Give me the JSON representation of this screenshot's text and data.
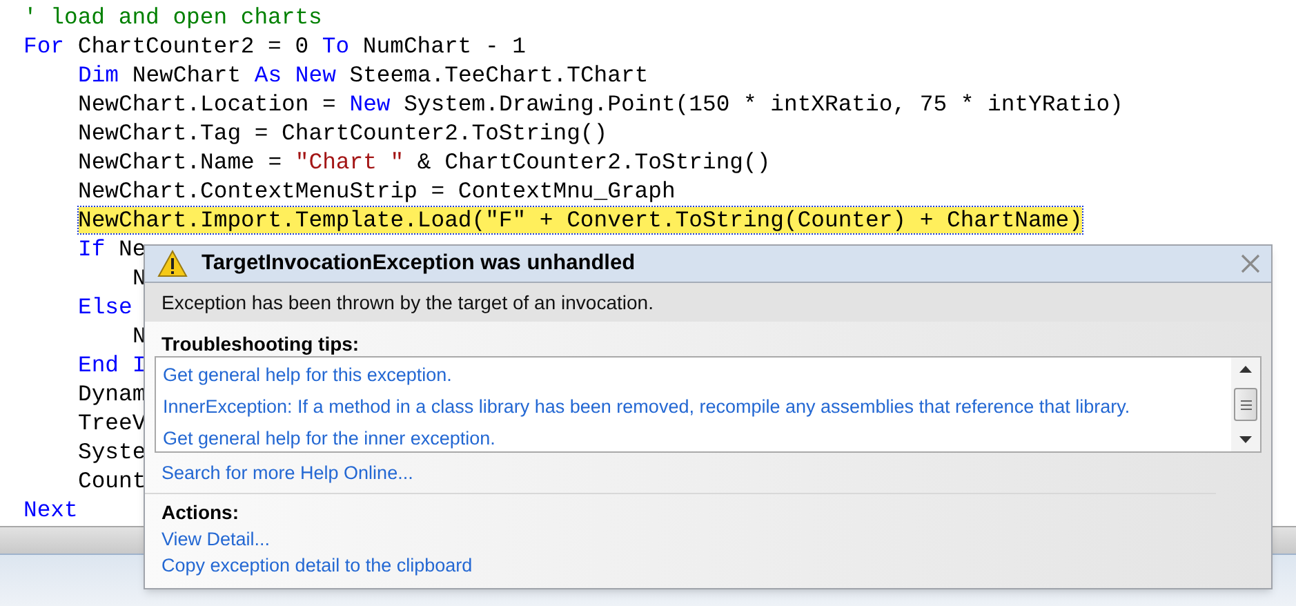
{
  "code": {
    "lines": [
      {
        "tokens": [
          {
            "kind": "comment",
            "text": "' load and open charts"
          }
        ]
      },
      {
        "tokens": [
          {
            "kind": "keyword",
            "text": "For"
          },
          {
            "kind": "plain",
            "text": " ChartCounter2 = 0 "
          },
          {
            "kind": "keyword",
            "text": "To"
          },
          {
            "kind": "plain",
            "text": " NumChart - 1"
          }
        ],
        "children": [
          {
            "tokens": [
              {
                "kind": "keyword",
                "text": "Dim"
              },
              {
                "kind": "plain",
                "text": " NewChart "
              },
              {
                "kind": "keyword",
                "text": "As New"
              },
              {
                "kind": "plain",
                "text": " Steema.TeeChart.TChart"
              }
            ]
          },
          {
            "tokens": [
              {
                "kind": "plain",
                "text": "NewChart.Location = "
              },
              {
                "kind": "keyword",
                "text": "New"
              },
              {
                "kind": "plain",
                "text": " System.Drawing.Point(150 * intXRatio, 75 * intYRatio)"
              }
            ]
          },
          {
            "tokens": [
              {
                "kind": "plain",
                "text": "NewChart.Tag = ChartCounter2.ToString()"
              }
            ]
          },
          {
            "tokens": [
              {
                "kind": "plain",
                "text": "NewChart.Name = "
              },
              {
                "kind": "string",
                "text": "\"Chart \""
              },
              {
                "kind": "plain",
                "text": " & ChartCounter2.ToString()"
              }
            ]
          },
          {
            "tokens": [
              {
                "kind": "plain",
                "text": "NewChart.ContextMenuStrip = ContextMnu_Graph"
              }
            ]
          },
          {
            "highlighted": true,
            "tokens": [
              {
                "kind": "plain",
                "text": "NewChart.Import.Template.Load(\"F\" + Convert.ToString(Counter) + ChartName)"
              }
            ]
          },
          {
            "tokens": [
              {
                "kind": "keyword",
                "text": "If"
              },
              {
                "kind": "plain",
                "text": " Ne"
              }
            ],
            "children": [
              {
                "text": "N"
              }
            ]
          },
          {
            "tokens": [
              {
                "kind": "keyword",
                "text": "Else"
              }
            ],
            "children": [
              {
                "text": "N"
              }
            ]
          },
          {
            "tokens": [
              {
                "kind": "keyword",
                "text": "End I"
              }
            ]
          },
          {
            "tokens": [
              {
                "kind": "plain",
                "text": "Dynam"
              }
            ]
          },
          {
            "tokens": [
              {
                "kind": "plain",
                "text": "TreeV"
              }
            ]
          },
          {
            "tokens": [
              {
                "kind": "plain",
                "text": "Syste"
              }
            ]
          },
          {
            "tokens": [
              {
                "kind": "plain",
                "text": "Count"
              }
            ]
          }
        ]
      },
      {
        "tokens": [
          {
            "kind": "keyword",
            "text": "Next"
          }
        ]
      }
    ]
  },
  "exception_dialog": {
    "title": "TargetInvocationException was unhandled",
    "message": "Exception has been thrown by the target of an invocation.",
    "tips_heading": "Troubleshooting tips:",
    "tips": [
      "Get general help for this exception.",
      "InnerException: If a method in a class library has been removed, recompile any assemblies that reference that library.",
      "Get general help for the inner exception."
    ],
    "search_link": "Search for more Help Online...",
    "actions_heading": "Actions:",
    "actions": [
      "View Detail...",
      "Copy exception detail to the clipboard"
    ]
  }
}
